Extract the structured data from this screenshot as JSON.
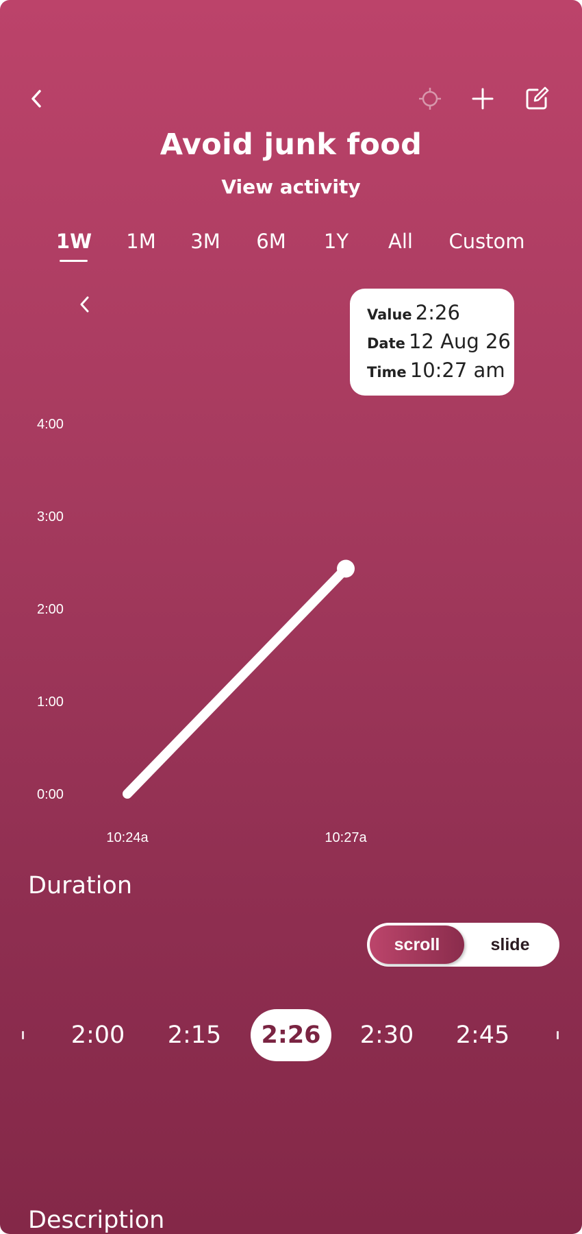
{
  "header": {
    "title": "Avoid junk food",
    "subtitle": "View activity",
    "icons": [
      "back-icon",
      "target-icon",
      "plus-icon",
      "edit-icon"
    ]
  },
  "tabs": [
    {
      "label": "1W",
      "active": true
    },
    {
      "label": "1M",
      "active": false
    },
    {
      "label": "3M",
      "active": false
    },
    {
      "label": "6M",
      "active": false
    },
    {
      "label": "1Y",
      "active": false
    },
    {
      "label": "All",
      "active": false
    },
    {
      "label": "Custom",
      "active": false
    }
  ],
  "tooltip": {
    "value_label": "Value",
    "value": "2:26",
    "date_label": "Date",
    "date": "12 Aug 26",
    "time_label": "Time",
    "time": "10:27 am"
  },
  "chart_data": {
    "type": "line",
    "x_tick_labels": [
      "10:24a",
      "10:27a"
    ],
    "y_tick_labels": [
      "0:00",
      "1:00",
      "2:00",
      "3:00",
      "4:00"
    ],
    "ylim": [
      0,
      240
    ],
    "series": [
      {
        "points": [
          {
            "x": "10:24a",
            "y": 0
          },
          {
            "x": "10:27a",
            "y": 146
          }
        ]
      }
    ],
    "highlighted_point": {
      "x": "10:27a",
      "y": 146
    }
  },
  "duration": {
    "label": "Duration",
    "mode_options": [
      "scroll",
      "slide"
    ],
    "selected_mode": "scroll",
    "values": [
      "2:00",
      "2:15",
      "2:26",
      "2:30",
      "2:45"
    ],
    "selected_value": "2:26"
  },
  "description": {
    "label": "Description"
  },
  "colors": {
    "accent": "#bc436a",
    "accent_dark": "#842848",
    "selected_text": "#7a2442"
  }
}
